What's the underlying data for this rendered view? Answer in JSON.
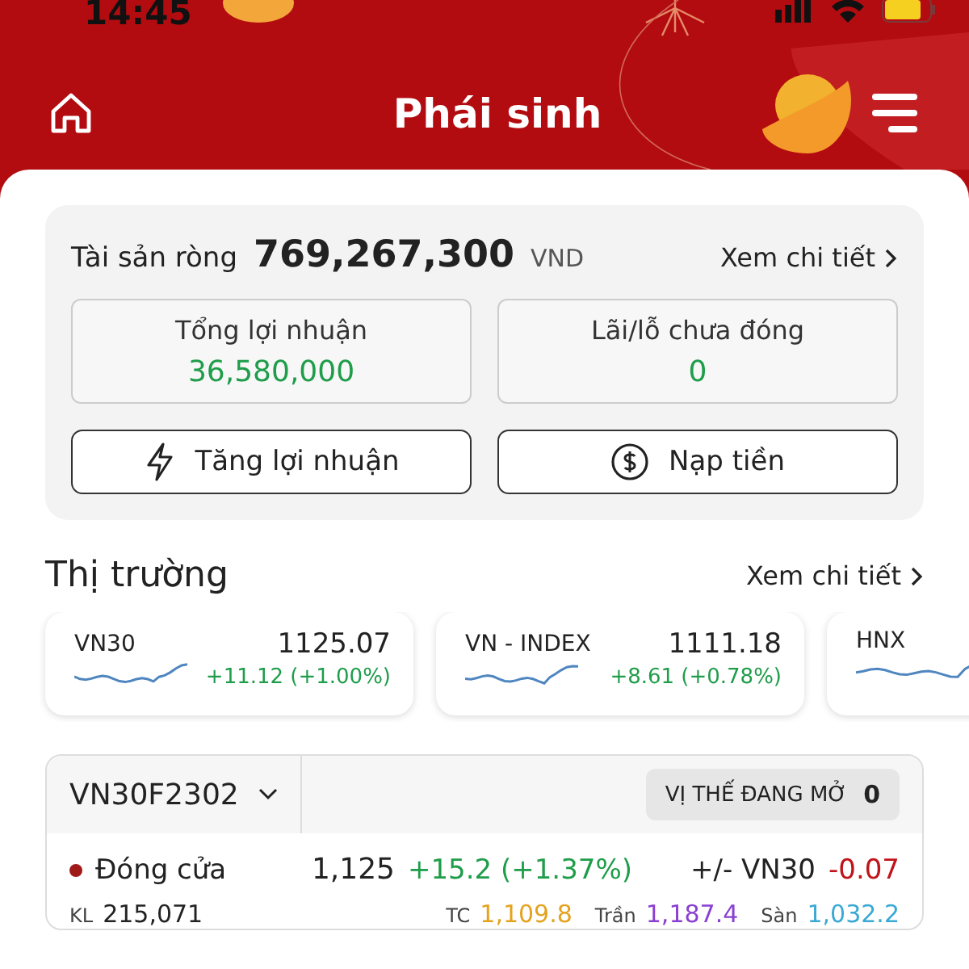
{
  "status_bar": {
    "time": "14:45"
  },
  "header": {
    "title": "Phái sinh"
  },
  "assets": {
    "label": "Tài sản ròng",
    "value": "769,267,300",
    "currency": "VND",
    "detail_link": "Xem chi tiết",
    "stats": [
      {
        "label": "Tổng lợi nhuận",
        "value": "36,580,000"
      },
      {
        "label": "Lãi/lỗ chưa đóng",
        "value": "0"
      }
    ],
    "buttons": [
      {
        "label": "Tăng lợi nhuận",
        "kind": "bolt"
      },
      {
        "label": "Nạp tiền",
        "kind": "dollar"
      }
    ]
  },
  "market": {
    "title": "Thị trường",
    "detail_link": "Xem chi tiết",
    "indices": [
      {
        "name": "VN30",
        "value": "1125.07",
        "change": "+11.12 (+1.00%)"
      },
      {
        "name": "VN - INDEX",
        "value": "1111.18",
        "change": "+8.61 (+0.78%)"
      },
      {
        "name": "HNX"
      }
    ]
  },
  "contract": {
    "symbol": "VN30F2302",
    "open_positions_label": "VỊ THẾ ĐANG MỞ",
    "open_positions": "0",
    "status": "Đóng cửa",
    "price": "1,125",
    "change": "+15.2 (+1.37%)",
    "basis_label": "+/- VN30",
    "basis": "-0.07",
    "volume_label": "KL",
    "volume": "215,071",
    "references": [
      {
        "label": "TC",
        "value": "1,109.8",
        "color": "#e5a21c"
      },
      {
        "label": "Trần",
        "value": "1,187.4",
        "color": "#8a3fd1"
      },
      {
        "label": "Sàn",
        "value": "1,032.2",
        "color": "#3aa9d4"
      }
    ]
  }
}
